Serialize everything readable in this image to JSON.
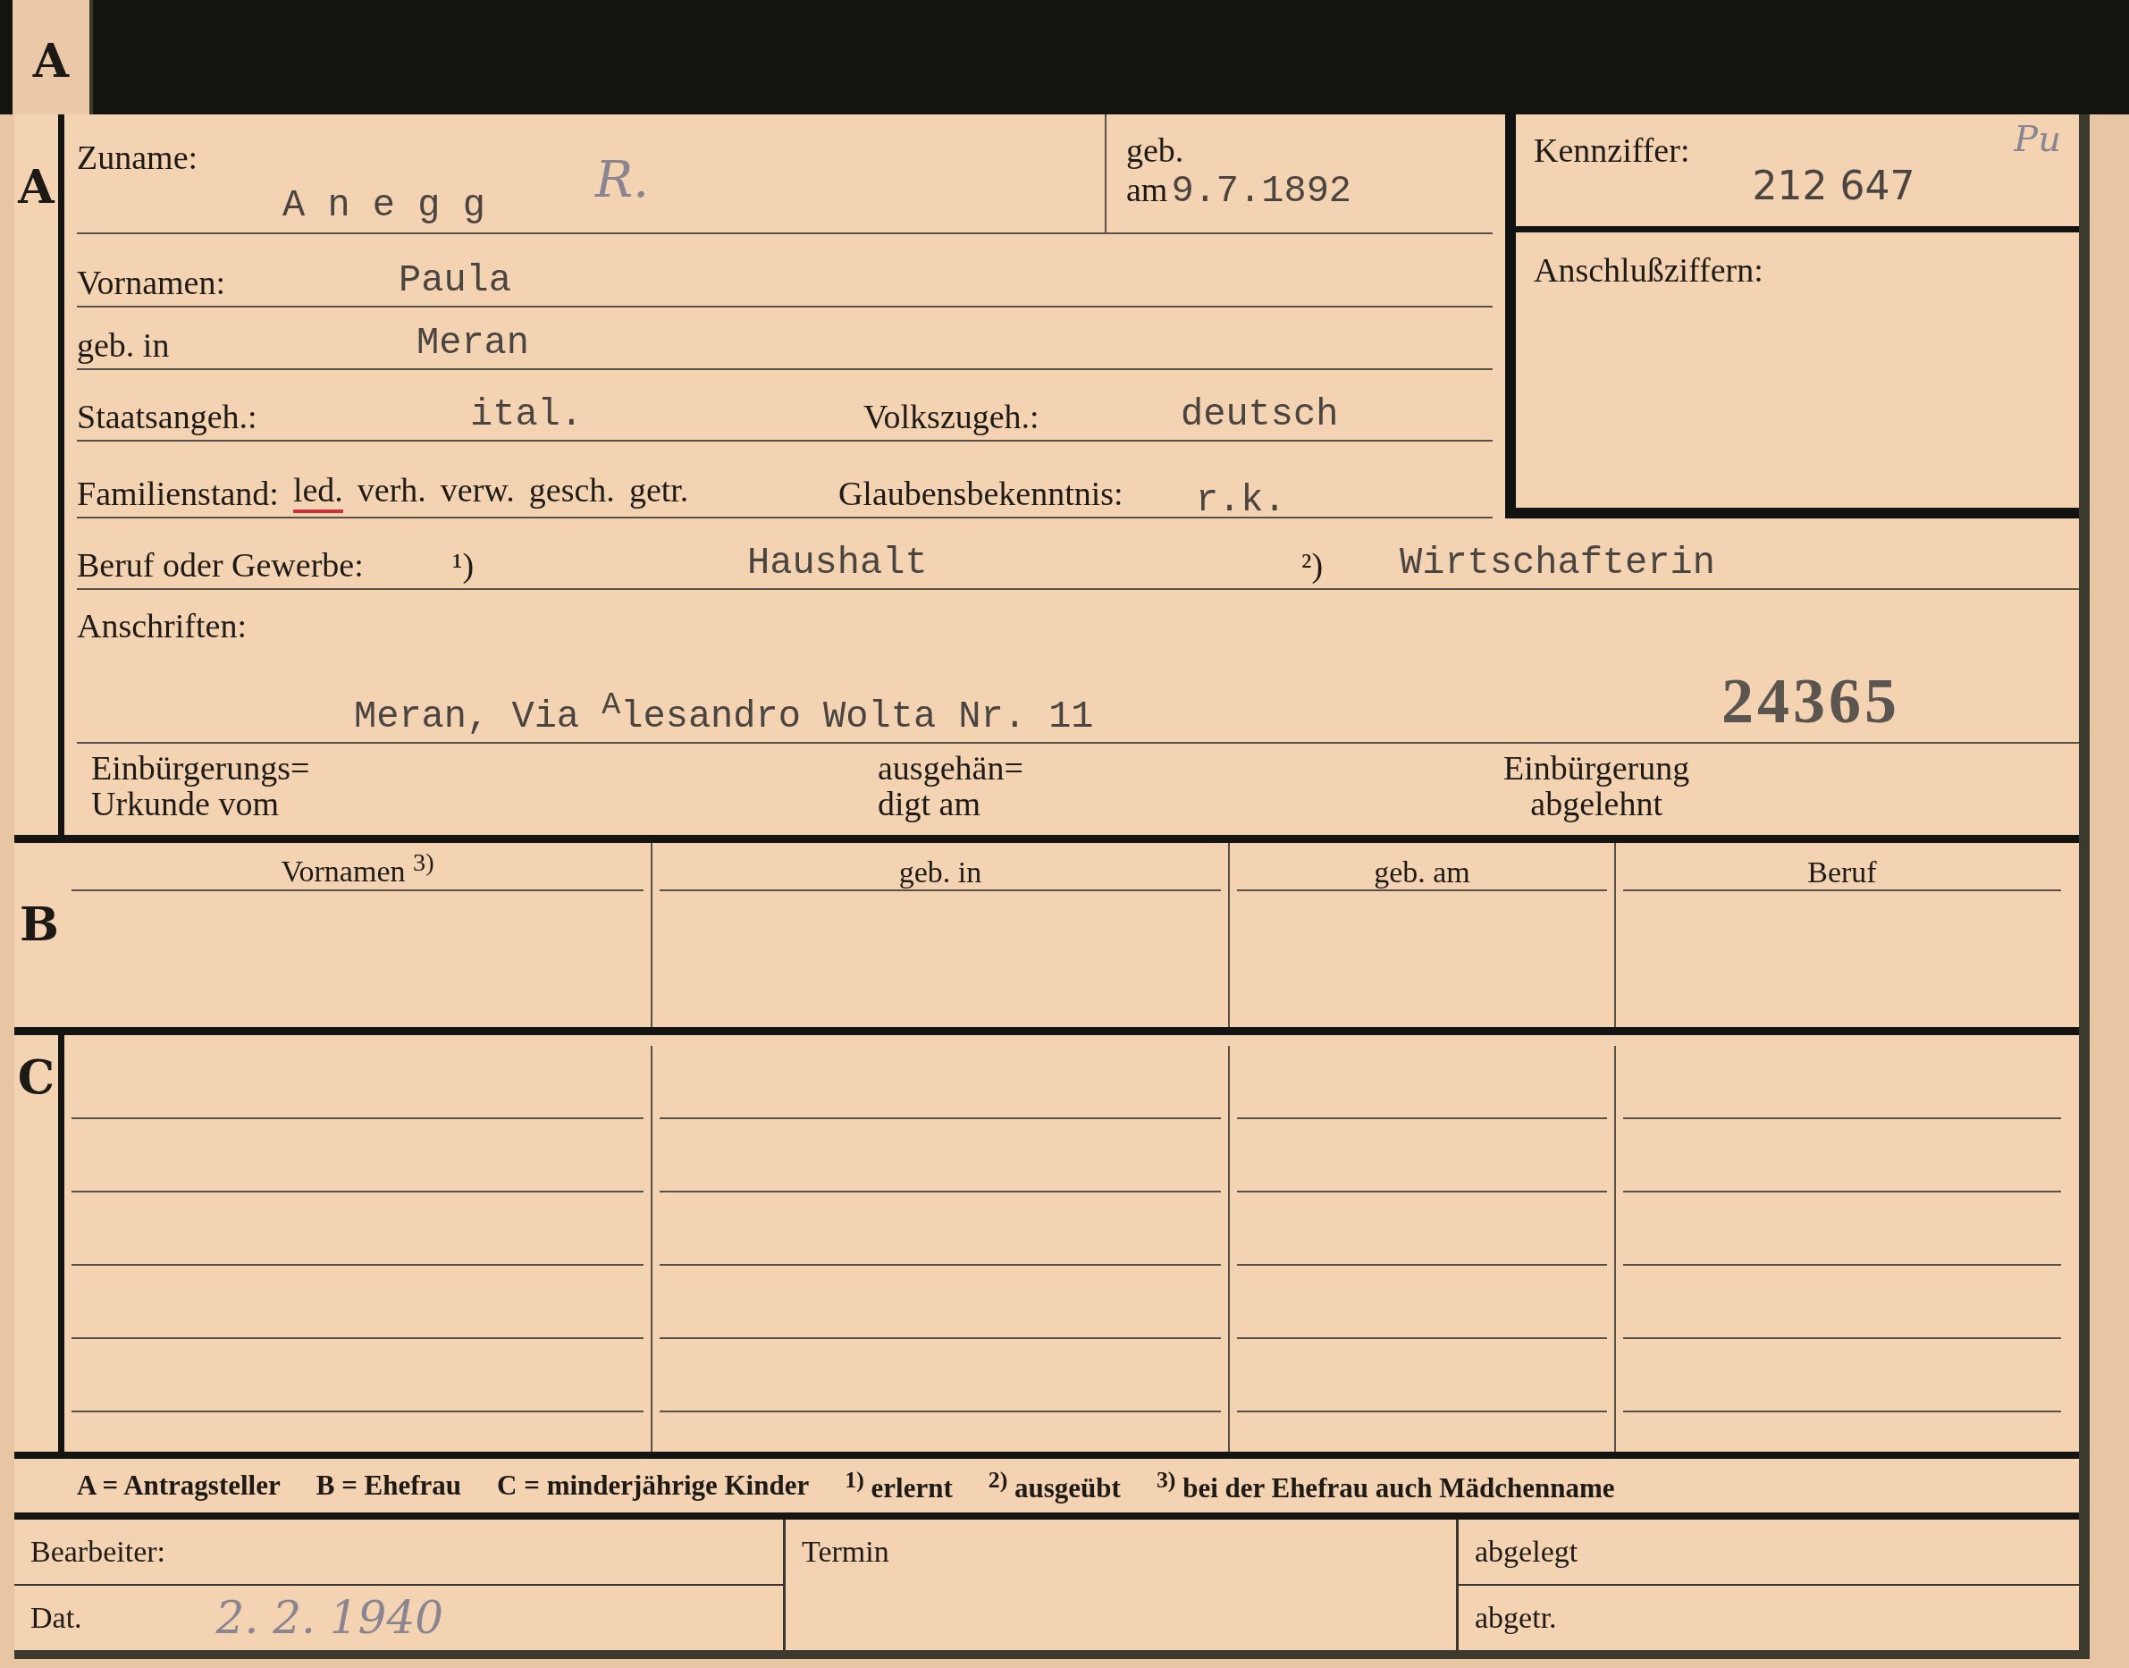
{
  "tab_letter": "A",
  "section_a": {
    "letter": "A",
    "surname": {
      "label": "Zuname:",
      "value": "A n e g g",
      "note": "R."
    },
    "birth_date": {
      "label_1": "geb.",
      "label_2": "am",
      "value": "9.7.1892"
    },
    "first_names": {
      "label": "Vornamen:",
      "value": "Paula"
    },
    "birthplace": {
      "label": "geb. in",
      "value": "Meran"
    },
    "citizenship": {
      "label": "Staatsangeh.:",
      "value": "ital."
    },
    "ethnicity": {
      "label": "Volkszugeh.:",
      "value": "deutsch"
    },
    "marital_status": {
      "label": "Familienstand:",
      "options": [
        {
          "label": "led.",
          "selected": true
        },
        {
          "label": "verh.",
          "selected": false
        },
        {
          "label": "verw.",
          "selected": false
        },
        {
          "label": "gesch.",
          "selected": false
        },
        {
          "label": "getr.",
          "selected": false
        }
      ]
    },
    "religion": {
      "label": "Glaubensbekenntnis:",
      "value": "r.k."
    },
    "occupation": {
      "label": "Beruf oder Gewerbe:",
      "mark_1": "¹)",
      "value_1": "Haushalt",
      "mark_2": "²)",
      "value_2": "Wirtschafterin"
    },
    "addresses": {
      "label": "Anschriften:",
      "value": "Meran, Via $^{A}$lesandro Wolta Nr. 11",
      "stamp": "24365"
    },
    "naturalization": [
      {
        "lines": [
          "Einbürgerungs=",
          "Urkunde vom"
        ]
      },
      {
        "lines": [
          "ausgehän=",
          "digt am"
        ]
      },
      {
        "lines": [
          "Einbürgerung",
          "abgelehnt"
        ]
      }
    ]
  },
  "id_box": {
    "initials": "Pu",
    "label": "Kennziffer:",
    "value": "212 647",
    "link_label": "Anschlußziffern:"
  },
  "section_b": {
    "letter": "B",
    "columns": [
      "Vornamen $^{3)}$",
      "geb. in",
      "geb. am",
      "Beruf"
    ]
  },
  "section_c": {
    "letter": "C"
  },
  "legend": [
    "A = Antragsteller",
    "B = Ehefrau",
    "C = minderjährige Kinder",
    "$^{1)}$ erlernt",
    "$^{2)}$ ausgeübt",
    "$^{3)}$ bei der Ehefrau auch Mädchenname"
  ],
  "footer": {
    "clerk_label": "Bearbeiter:",
    "date_label": "Dat.",
    "date_value": "2. 2. 1940",
    "deadline_label": "Termin",
    "filed_label": "abgelegt",
    "removed_label": "abgetr."
  }
}
